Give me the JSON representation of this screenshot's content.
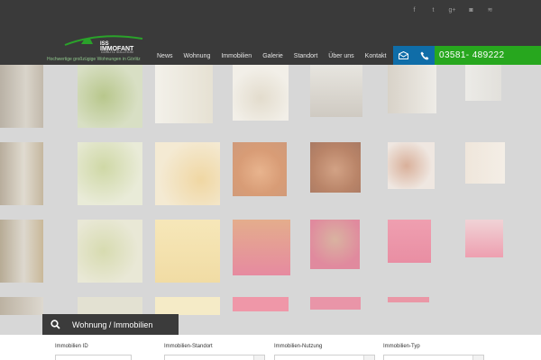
{
  "social": [
    {
      "icon": "facebook-icon",
      "glyph": "f"
    },
    {
      "icon": "twitter-icon",
      "glyph": "t"
    },
    {
      "icon": "google-plus-icon",
      "glyph": "g+"
    },
    {
      "icon": "instagram-icon",
      "glyph": "◙"
    },
    {
      "icon": "rss-icon",
      "glyph": "≋"
    }
  ],
  "logo": {
    "small": "ISS",
    "big": "IMMOFANT",
    "sub": "GÖRLITZ SOLUTION"
  },
  "tagline": "Hochwertige großzügige Wohnungen in Görlitz",
  "nav": [
    "News",
    "Wohnung",
    "Immobilien",
    "Galerie",
    "Standort",
    "Über uns",
    "Kontakt"
  ],
  "contact": {
    "phone": "03581- 489222"
  },
  "colors": {
    "header": "#3a3a3a",
    "accent_green": "#27a71e",
    "accent_blue": "#0f6da8"
  },
  "search": {
    "tab_label": "Wohnung / Immobilien",
    "fields": [
      {
        "label": "Immobilien ID"
      },
      {
        "label": "Immobilien-Standort"
      },
      {
        "label": "Immobilien-Nutzung"
      },
      {
        "label": "Immobilien-Typ"
      }
    ]
  }
}
